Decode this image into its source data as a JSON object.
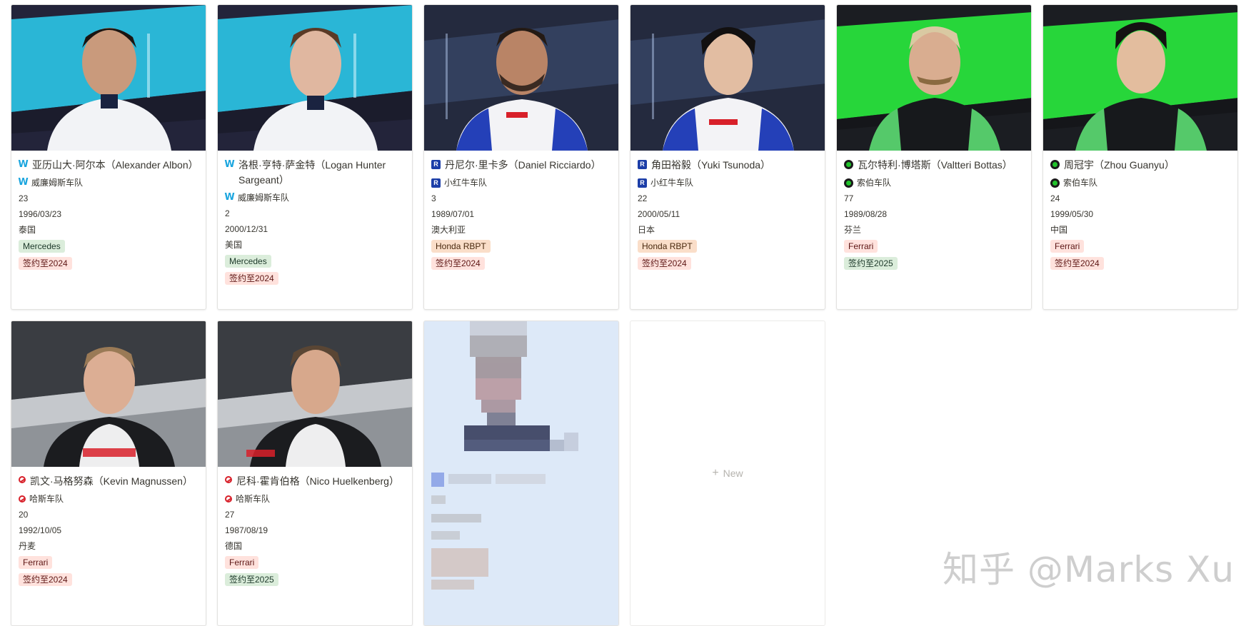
{
  "cards": [
    {
      "name": "亚历山大·阿尔本（Alexander Albon）",
      "team": "威廉姆斯车队",
      "number": "23",
      "birthday": "1996/03/23",
      "country": "泰国",
      "engine": "Mercedes",
      "contract": "签约至2024",
      "team_icon": "williams-icon",
      "bg": "#2ab6d6"
    },
    {
      "name": "洛根·亨特·萨金特（Logan Hunter Sargeant）",
      "team": "威廉姆斯车队",
      "number": "2",
      "birthday": "2000/12/31",
      "country": "美国",
      "engine": "Mercedes",
      "contract": "签约至2024",
      "team_icon": "williams-icon",
      "bg": "#2ab6d6"
    },
    {
      "name": "丹尼尔·里卡多（Daniel Ricciardo）",
      "team": "小红牛车队",
      "number": "3",
      "birthday": "1989/07/01",
      "country": "澳大利亚",
      "engine": "Honda RBPT",
      "contract": "签约至2024",
      "team_icon": "rb-icon",
      "bg": "#1f2a44"
    },
    {
      "name": "角田裕毅（Yuki Tsunoda）",
      "team": "小红牛车队",
      "number": "22",
      "birthday": "2000/05/11",
      "country": "日本",
      "engine": "Honda RBPT",
      "contract": "签约至2024",
      "team_icon": "rb-icon",
      "bg": "#1f2a44"
    },
    {
      "name": "瓦尔特利·博塔斯（Valtteri Bottas）",
      "team": "索伯车队",
      "number": "77",
      "birthday": "1989/08/28",
      "country": "芬兰",
      "engine": "Ferrari",
      "contract": "签约至2025",
      "team_icon": "sauber-icon",
      "bg": "#27d63a"
    },
    {
      "name": "周冠宇（Zhou Guanyu）",
      "team": "索伯车队",
      "number": "24",
      "birthday": "1999/05/30",
      "country": "中国",
      "engine": "Ferrari",
      "contract": "签约至2024",
      "team_icon": "sauber-icon",
      "bg": "#27d63a"
    },
    {
      "name": "凯文·马格努森（Kevin Magnussen）",
      "team": "哈斯车队",
      "number": "20",
      "birthday": "1992/10/05",
      "country": "丹麦",
      "engine": "Ferrari",
      "contract": "签约至2024",
      "team_icon": "haas-icon",
      "bg": "#9a9ea3"
    },
    {
      "name": "尼科·霍肯伯格（Nico Huelkenberg）",
      "team": "哈斯车队",
      "number": "27",
      "birthday": "1987/08/19",
      "country": "德国",
      "engine": "Ferrari",
      "contract": "签约至2025",
      "team_icon": "haas-icon",
      "bg": "#9a9ea3"
    }
  ],
  "new_button": "New",
  "watermark": "知乎 @Marks Xu",
  "colors": {
    "tag_green_bg": "#dbeddb",
    "tag_red_bg": "#ffe2dd",
    "tag_orange_bg": "#fadec9",
    "blurred_card_bg": "#dde9f8"
  }
}
